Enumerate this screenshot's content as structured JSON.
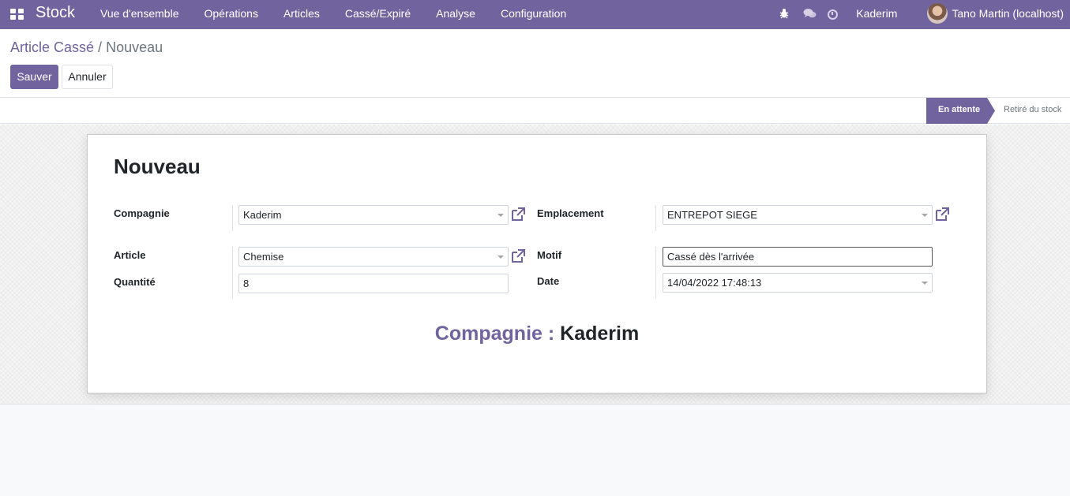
{
  "navbar": {
    "apps_icon": "apps-grid-icon",
    "brand": "Stock",
    "menu": [
      "Vue d'ensemble",
      "Opérations",
      "Articles",
      "Cassé/Expiré",
      "Analyse",
      "Configuration"
    ],
    "debug_icon": "bug-icon",
    "chat_icon": "chat-icon",
    "activity_icon": "clock-icon",
    "company": "Kaderim",
    "user": "Tano Martin (localhost)",
    "color": "#71639e"
  },
  "breadcrumb": {
    "parent": "Article Cassé",
    "separator": "/",
    "current": "Nouveau"
  },
  "buttons": {
    "save": "Sauver",
    "cancel": "Annuler"
  },
  "statusbar": {
    "active": "En attente",
    "next": "Retiré du stock"
  },
  "form": {
    "title": "Nouveau",
    "left": {
      "company_label": "Compagnie",
      "company_value": "Kaderim",
      "product_label": "Article",
      "product_value": "Chemise",
      "quantity_label": "Quantité",
      "quantity_value": "8"
    },
    "right": {
      "location_label": "Emplacement",
      "location_value": "ENTREPOT SIEGE",
      "reason_label": "Motif",
      "reason_value": "Cassé dès l'arrivée",
      "date_label": "Date",
      "date_value": "14/04/2022 17:48:13"
    },
    "external_link_icon": "external-link-icon",
    "footer": {
      "label": "Compagnie :",
      "value": "Kaderim"
    }
  }
}
